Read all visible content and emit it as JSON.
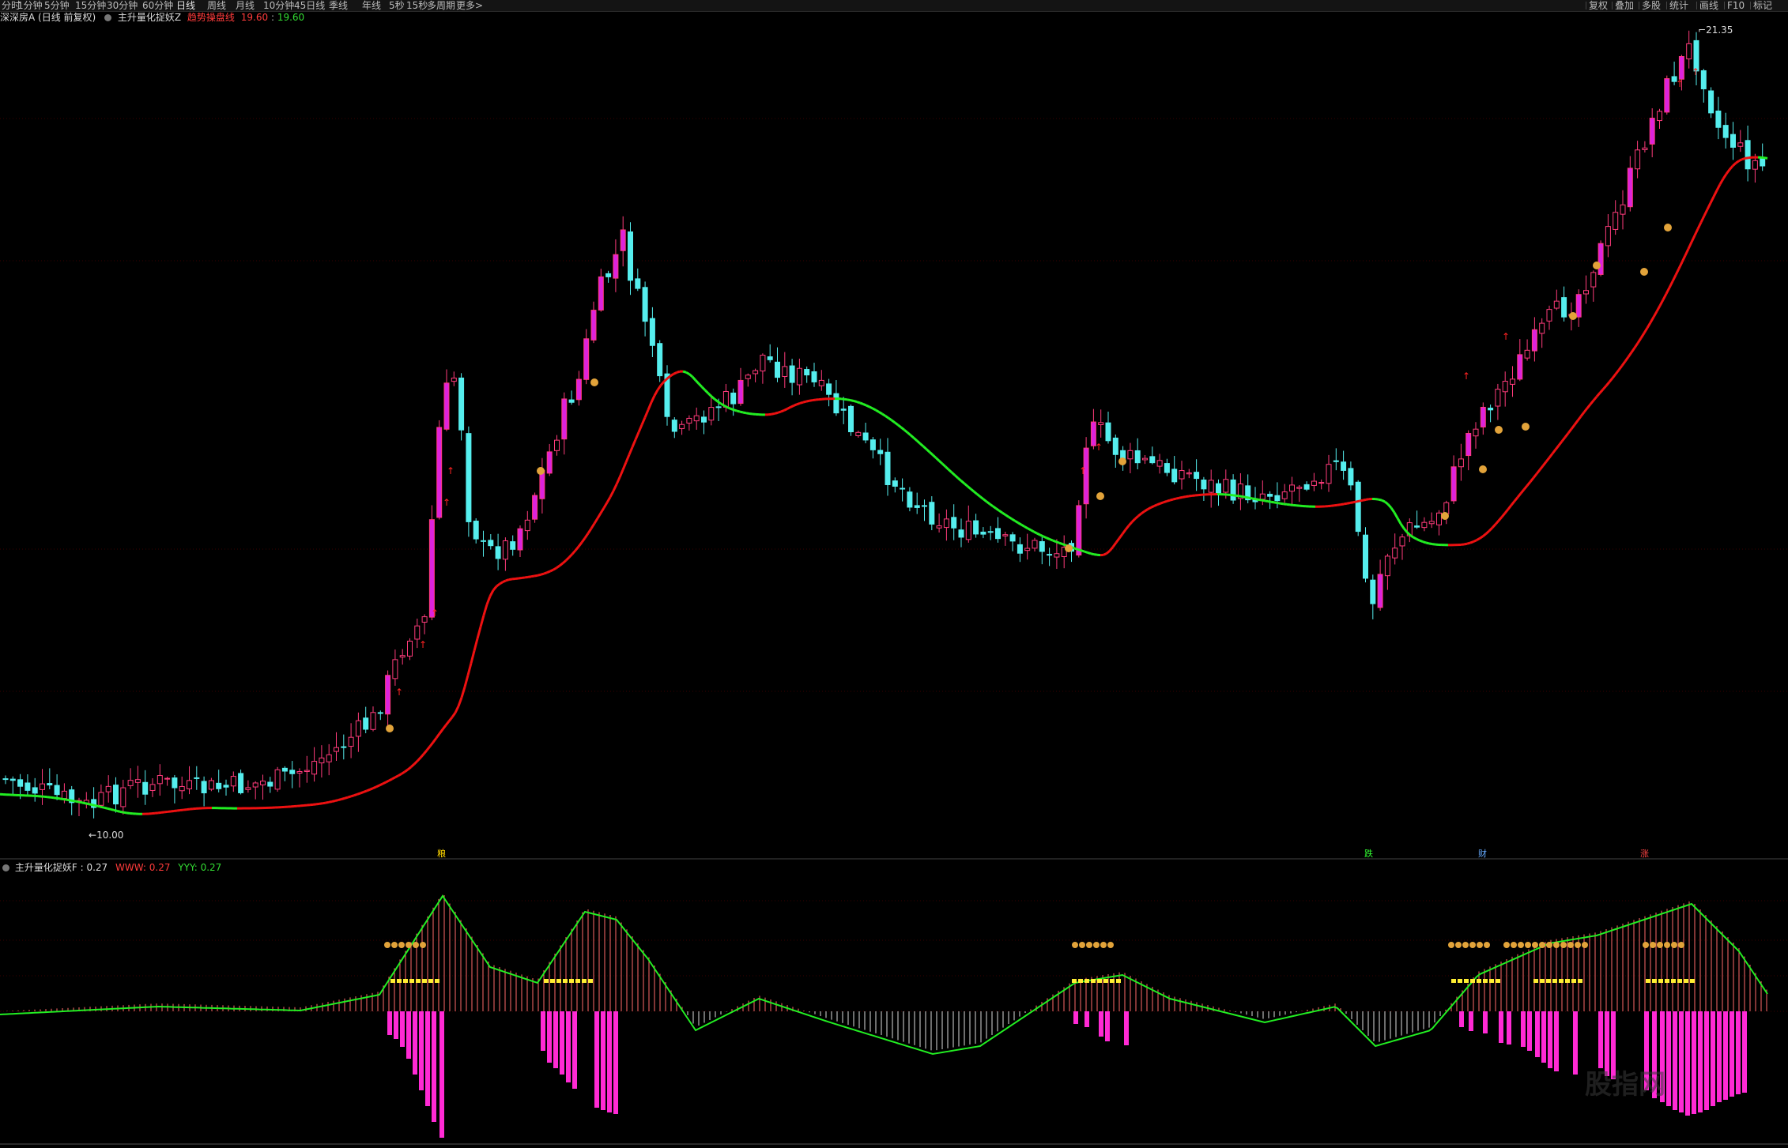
{
  "periods": [
    "分时",
    "1分钟",
    "5分钟",
    "15分钟",
    "30分钟",
    "60分钟",
    "日线",
    "周线",
    "月线",
    "10分钟",
    "45日线",
    "季线",
    "年线",
    "5秒",
    "15秒",
    "多周期",
    "更多>"
  ],
  "active_period": "日线",
  "right_buttons": [
    "复权",
    "叠加",
    "多股",
    "统计",
    "画线",
    "F10",
    "标记"
  ],
  "stock_title": "深深房A (日线 前复权)",
  "indicator_main": {
    "name": "主升量化捉妖Z",
    "field1_label": "趋势操盘线",
    "field1_value": "19.60",
    "field2_value": "19.60"
  },
  "indicator_sub": {
    "name": "主升量化捉妖F",
    "value": "0.27",
    "www_label": "WWW",
    "www_value": "0.27",
    "yyy_label": "YYY",
    "yyy_value": "0.27"
  },
  "price_high_label": "21.35",
  "price_low_label": "10.00",
  "markers": [
    "粮",
    "跌",
    "财",
    "涨"
  ],
  "watermark": "股指网",
  "colors": {
    "up": "#ff3b7b",
    "up_fill": "#dd22dd",
    "down": "#55eeee",
    "trend_red": "#ee1111",
    "trend_green": "#22ee22",
    "pink_bar": "#ff2ad4",
    "title_red": "#ff3b3b",
    "title_green": "#33dd33"
  }
}
